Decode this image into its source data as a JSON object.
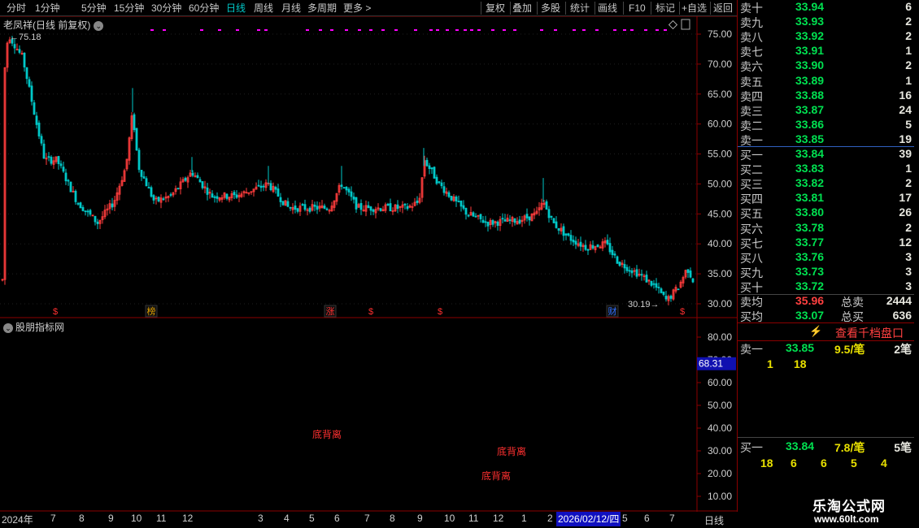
{
  "toolbar": {
    "periods": [
      "分时",
      "1分钟",
      "5分钟",
      "15分钟",
      "30分钟",
      "60分钟",
      "日线",
      "周线",
      "月线",
      "多周期",
      "更多 >"
    ],
    "active_period": "日线",
    "actions": [
      "复权",
      "叠加",
      "多股",
      "统计",
      "画线",
      "F10",
      "标记",
      "+自选",
      "返回"
    ]
  },
  "chart": {
    "title": "老凤祥(日线 前复权)",
    "high_label": "75.18",
    "low_label": "30.19",
    "price_axis": [
      "75.00",
      "70.00",
      "65.00",
      "60.00",
      "55.00",
      "50.00",
      "45.00",
      "40.00",
      "35.00",
      "30.00"
    ],
    "markers": [
      {
        "text": "$",
        "color": "#ff3030"
      },
      {
        "text": "榜",
        "color": "#e0a000",
        "boxed": true
      },
      {
        "text": "涨",
        "color": "#ff3030",
        "boxed": true
      },
      {
        "text": "$",
        "color": "#ff3030"
      },
      {
        "text": "$",
        "color": "#ff3030"
      },
      {
        "text": "财",
        "color": "#3070ff",
        "boxed": true
      },
      {
        "text": "$",
        "color": "#ff3030"
      }
    ]
  },
  "indicator": {
    "title": "股朋指标网",
    "axis": [
      "80.00",
      "70.00",
      "60.00",
      "50.00",
      "40.00",
      "30.00",
      "20.00",
      "10.00"
    ],
    "current_value": "68.31",
    "signals": [
      "底背离",
      "底背离",
      "底背离"
    ]
  },
  "orderbook": {
    "sells": [
      {
        "label": "卖十",
        "price": "33.94",
        "vol": "6"
      },
      {
        "label": "卖九",
        "price": "33.93",
        "vol": "2"
      },
      {
        "label": "卖八",
        "price": "33.92",
        "vol": "2"
      },
      {
        "label": "卖七",
        "price": "33.91",
        "vol": "1"
      },
      {
        "label": "卖六",
        "price": "33.90",
        "vol": "2"
      },
      {
        "label": "卖五",
        "price": "33.89",
        "vol": "1"
      },
      {
        "label": "卖四",
        "price": "33.88",
        "vol": "16"
      },
      {
        "label": "卖三",
        "price": "33.87",
        "vol": "24"
      },
      {
        "label": "卖二",
        "price": "33.86",
        "vol": "5"
      },
      {
        "label": "卖一",
        "price": "33.85",
        "vol": "19"
      }
    ],
    "buys": [
      {
        "label": "买一",
        "price": "33.84",
        "vol": "39"
      },
      {
        "label": "买二",
        "price": "33.83",
        "vol": "1"
      },
      {
        "label": "买三",
        "price": "33.82",
        "vol": "2"
      },
      {
        "label": "买四",
        "price": "33.81",
        "vol": "17"
      },
      {
        "label": "买五",
        "price": "33.80",
        "vol": "26"
      },
      {
        "label": "买六",
        "price": "33.78",
        "vol": "2"
      },
      {
        "label": "买七",
        "price": "33.77",
        "vol": "12"
      },
      {
        "label": "买八",
        "price": "33.76",
        "vol": "3"
      },
      {
        "label": "买九",
        "price": "33.73",
        "vol": "3"
      },
      {
        "label": "买十",
        "price": "33.72",
        "vol": "3"
      }
    ],
    "avg_sell": {
      "label": "卖均",
      "price": "35.96",
      "total_label": "总卖",
      "total": "2444"
    },
    "avg_buy": {
      "label": "买均",
      "price": "33.07",
      "total_label": "总买",
      "total": "636"
    },
    "thousand_button": "查看千档盘口",
    "sell1_detail": {
      "label": "卖一",
      "price": "33.85",
      "per": "9.5/笔",
      "count": "2笔",
      "orders": [
        "1",
        "18"
      ]
    },
    "buy1_detail": {
      "label": "买一",
      "price": "33.84",
      "per": "7.8/笔",
      "count": "5笔",
      "orders": [
        "18",
        "6",
        "6",
        "5",
        "4"
      ]
    }
  },
  "date_axis": {
    "labels": [
      "2024年",
      "7",
      "8",
      "9",
      "10",
      "11",
      "12",
      "3",
      "4",
      "5",
      "6",
      "7",
      "8",
      "9",
      "10",
      "11",
      "12",
      "1",
      "2",
      "5",
      "6",
      "7"
    ],
    "cursor": "2026/02/12/四",
    "period": "日线"
  },
  "logo": {
    "title": "乐淘公式网",
    "url": "www.60lt.com"
  },
  "colors": {
    "up": "#ff3c3c",
    "down": "#00c8c8",
    "magenta": "#ff00ff",
    "grid": "#8b0000"
  }
}
